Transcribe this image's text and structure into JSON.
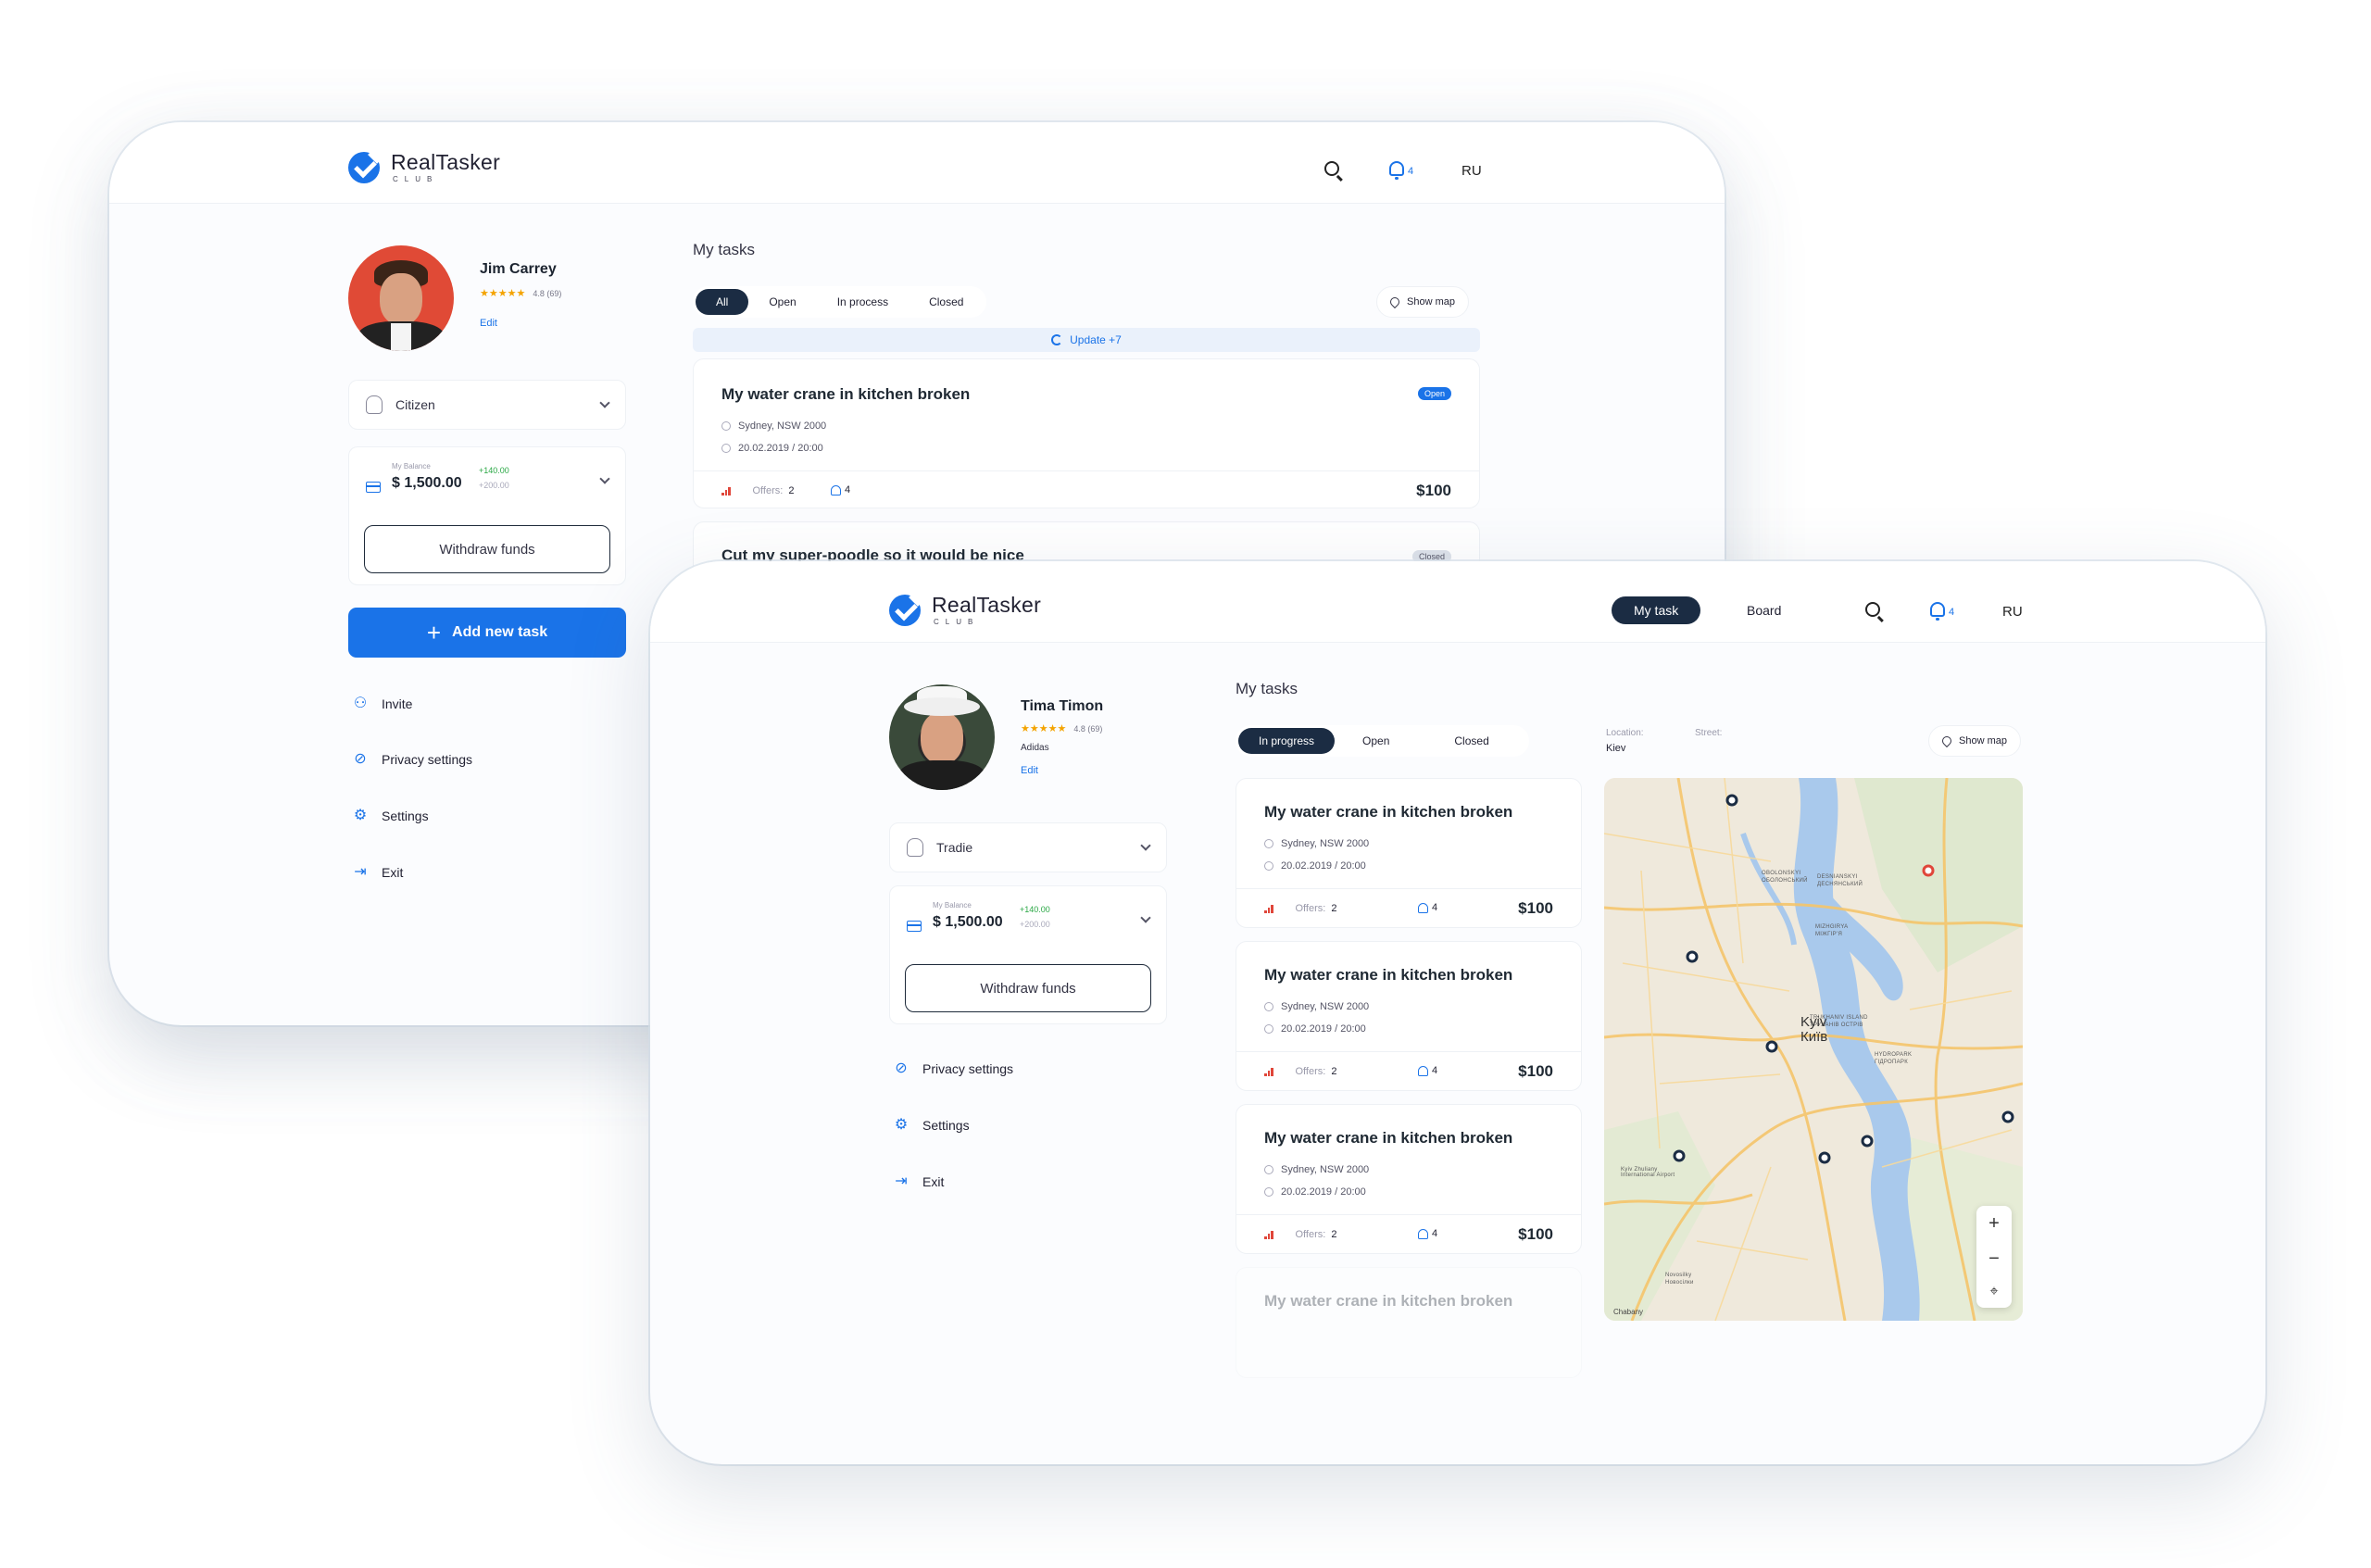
{
  "brand": {
    "name": "RealTasker",
    "sub": "CLUB"
  },
  "colors": {
    "accent": "#1a73e8",
    "dark": "#1b2c43",
    "danger": "#e0463a",
    "success": "#2aa845"
  },
  "back": {
    "header": {
      "notifications": "4",
      "lang": "RU"
    },
    "profile": {
      "name": "Jim Carrey",
      "rating": "4.8 (69)",
      "edit": "Edit"
    },
    "role": "Citizen",
    "balance": {
      "label": "My Balance",
      "value": "$ 1,500.00",
      "plus": "+140.00",
      "minus": "+200.00"
    },
    "withdraw": "Withdraw funds",
    "add_task": "Add new task",
    "menu": [
      "Invite",
      "Privacy settings",
      "Settings",
      "Exit"
    ],
    "section_title": "My tasks",
    "tabs": [
      "All",
      "Open",
      "In process",
      "Closed"
    ],
    "show_map": "Show map",
    "update": "Update +7",
    "tasks": [
      {
        "title": "My water crane in kitchen broken",
        "location": "Sydney, NSW 2000",
        "date": "20.02.2019  /  20:00",
        "offers_label": "Offers:",
        "offers": "2",
        "notify": "4",
        "price": "$100",
        "status": "Open"
      },
      {
        "title": "Cut my super-poodle so it would be nice",
        "status": "Closed"
      }
    ]
  },
  "front": {
    "header": {
      "nav_active": "My task",
      "nav_board": "Board",
      "notifications": "4",
      "lang": "RU"
    },
    "profile": {
      "name": "Tima Timon",
      "rating": "4.8 (69)",
      "company": "Adidas",
      "edit": "Edit"
    },
    "role": "Tradie",
    "balance": {
      "label": "My Balance",
      "value": "$ 1,500.00",
      "plus": "+140.00",
      "minus": "+200.00"
    },
    "withdraw": "Withdraw funds",
    "menu": [
      "Privacy settings",
      "Settings",
      "Exit"
    ],
    "section_title": "My tasks",
    "tabs": [
      "In progress",
      "Open",
      "Closed"
    ],
    "location_label": "Location:",
    "location_value": "Kiev",
    "street_label": "Street:",
    "show_map": "Show map",
    "tasks": [
      {
        "title": "My water crane in kitchen broken",
        "location": "Sydney, NSW 2000",
        "date": "20.02.2019  /  20:00",
        "offers_label": "Offers:",
        "offers": "2",
        "notify": "4",
        "price": "$100"
      },
      {
        "title": "My water crane in kitchen broken",
        "location": "Sydney, NSW 2000",
        "date": "20.02.2019  /  20:00",
        "offers_label": "Offers:",
        "offers": "2",
        "notify": "4",
        "price": "$100"
      },
      {
        "title": "My water crane in kitchen broken",
        "location": "Sydney, NSW 2000",
        "date": "20.02.2019  /  20:00",
        "offers_label": "Offers:",
        "offers": "2",
        "notify": "4",
        "price": "$100"
      },
      {
        "title": "My water crane in kitchen broken"
      }
    ],
    "map": {
      "city_en": "Kyiv",
      "city_ua": "Київ",
      "labels": [
        "OBOLONSKYI",
        "ОБОЛОНСЬКИЙ",
        "DESNIANSKYI",
        "ДЕСНЯНСЬКИЙ",
        "MIZHGIRYA",
        "МІЖГІРʼЯ",
        "TRUKHANIV ISLAND",
        "ТРУХАНІВ ОСТРІВ",
        "HYDROPARK",
        "ГІДРОПАРК",
        "Kyiv Zhuliany International Airport",
        "Novosilky",
        "Новосілки",
        "Chabany"
      ],
      "zoom_in": "+",
      "zoom_out": "−"
    }
  }
}
